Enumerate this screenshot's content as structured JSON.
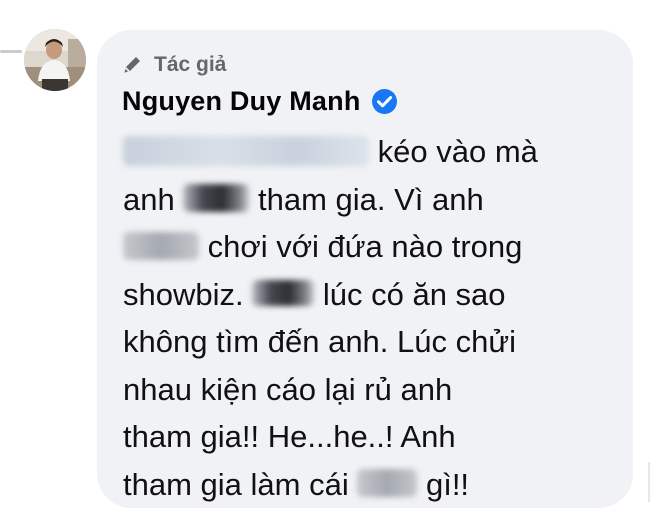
{
  "comment": {
    "author_badge": "Tác giả",
    "author_name": "Nguyen Duy Manh",
    "lines": [
      {
        "redacted": "",
        "text": "kéo vào mà"
      },
      {
        "pre": "anh",
        "redacted": "",
        "post": "tham gia. Vì anh"
      },
      {
        "redacted": "",
        "post": "chơi với đứa nào trong"
      },
      {
        "pre": "showbiz.",
        "redacted": "",
        "post": "lúc có ăn sao"
      },
      {
        "text": "không tìm đến anh. Lúc chửi"
      },
      {
        "text": "nhau kiện cáo lại rủ anh"
      },
      {
        "text": "tham gia!! He...he..! Anh"
      },
      {
        "pre": "tham gia làm cái",
        "redacted": "",
        "post": "gì!!"
      }
    ]
  },
  "icons": {
    "author_badge_icon": "pencil-icon",
    "verified_icon": "verified-badge-icon",
    "verified_color": "#1877f2"
  },
  "colors": {
    "bubble_background": "#f0f2f5",
    "text": "#050505",
    "secondary_text": "#65676b"
  }
}
